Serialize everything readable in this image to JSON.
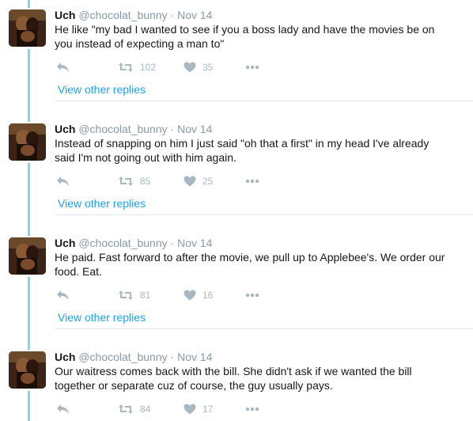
{
  "tweets": [
    {
      "name": "Uch",
      "handle": "@chocolat_bunny",
      "dot": "·",
      "date": "Nov 14",
      "text": "He like \"my bad I wanted to see if you a boss lady and have the movies be on you instead of expecting a man to\"",
      "retweets": "102",
      "likes": "35",
      "view_replies": "View other replies"
    },
    {
      "name": "Uch",
      "handle": "@chocolat_bunny",
      "dot": "·",
      "date": "Nov 14",
      "text": "Instead of snapping on him I just said \"oh that a first\" in my head I've already said I'm not going out with him again.",
      "retweets": "85",
      "likes": "25",
      "view_replies": "View other replies"
    },
    {
      "name": "Uch",
      "handle": "@chocolat_bunny",
      "dot": "·",
      "date": "Nov 14",
      "text": "He paid. Fast forward to after the movie, we pull up to Applebee's. We order our food. Eat.",
      "retweets": "81",
      "likes": "16",
      "view_replies": "View other replies"
    },
    {
      "name": "Uch",
      "handle": "@chocolat_bunny",
      "dot": "·",
      "date": "Nov 14",
      "text": "Our waitress comes back with the bill. She didn't ask if we wanted the bill together or separate cuz of course, the guy usually pays.",
      "retweets": "84",
      "likes": "17"
    }
  ],
  "icons": {
    "reply": "reply-icon",
    "retweet": "retweet-icon",
    "like": "heart-icon",
    "more": "more-icon"
  },
  "colors": {
    "thread_line": "#82d7e4",
    "link": "#1da1f2",
    "muted": "#8899a6",
    "action_icon": "#aab8c2",
    "separator": "#e1e8ed"
  }
}
